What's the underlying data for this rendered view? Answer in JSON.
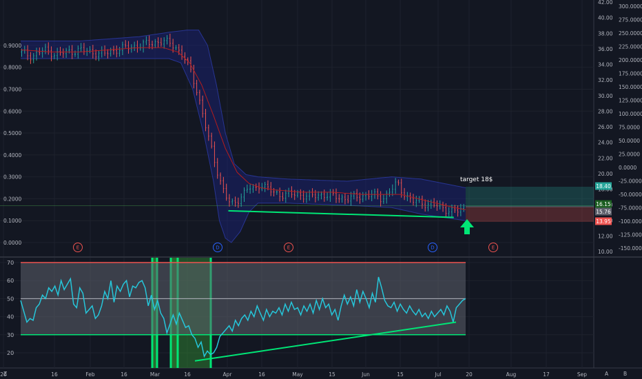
{
  "chart_data": [
    {
      "type": "candlestick",
      "title": "",
      "x_tick_labels": [
        "20",
        "16",
        "Feb",
        "16",
        "Mar",
        "16",
        "Apr",
        "16",
        "May",
        "15",
        "Jun",
        "15",
        "Jul",
        "20",
        "Aug",
        "17",
        "Sep"
      ],
      "left_axis": {
        "ticks": [
          "0.9000",
          "0.8000",
          "0.7000",
          "0.6000",
          "0.5000",
          "0.4000",
          "0.3000",
          "0.2000",
          "0.1000",
          "0.0000"
        ],
        "ylim": [
          -0.02,
          0.99
        ]
      },
      "right_axis_price": {
        "ticks": [
          "42.00",
          "40.00",
          "38.00",
          "36.00",
          "34.00",
          "32.00",
          "30.00",
          "28.00",
          "26.00",
          "24.00",
          "22.00",
          "20.00",
          "18.00",
          "16.00",
          "14.00",
          "12.00",
          "10.00"
        ]
      },
      "right_axis_indicator": {
        "ticks": [
          "300.0000",
          "275.0000",
          "250.0000",
          "225.0000",
          "200.0000",
          "175.0000",
          "150.0000",
          "125.0000",
          "100.0000",
          "75.0000",
          "50.0000",
          "25.0000",
          "0.0000",
          "-25.0000",
          "-50.0000",
          "-75.0000",
          "-100.0000",
          "-125.0000",
          "-150.0000"
        ]
      },
      "price_tags": [
        {
          "label": "18.40",
          "color": "#26a69a"
        },
        {
          "label": "16.15",
          "color": "#1b5e20"
        },
        {
          "label": "15.76",
          "color": "#5d606b"
        },
        {
          "label": "13.95",
          "color": "#ef5350"
        }
      ],
      "close_path": [
        [
          0,
          0.87
        ],
        [
          4,
          0.85
        ],
        [
          8,
          0.88
        ],
        [
          12,
          0.86
        ],
        [
          16,
          0.87
        ],
        [
          20,
          0.88
        ],
        [
          24,
          0.87
        ],
        [
          28,
          0.86
        ],
        [
          32,
          0.88
        ],
        [
          36,
          0.89
        ],
        [
          40,
          0.9
        ],
        [
          44,
          0.91
        ],
        [
          48,
          0.92
        ],
        [
          52,
          0.9
        ],
        [
          55,
          0.85
        ],
        [
          57,
          0.8
        ],
        [
          59,
          0.72
        ],
        [
          61,
          0.62
        ],
        [
          63,
          0.5
        ],
        [
          65,
          0.4
        ],
        [
          67,
          0.3
        ],
        [
          69,
          0.22
        ],
        [
          71,
          0.17
        ],
        [
          73,
          0.19
        ],
        [
          75,
          0.22
        ],
        [
          77,
          0.25
        ],
        [
          79,
          0.24
        ],
        [
          81,
          0.27
        ],
        [
          83,
          0.25
        ],
        [
          85,
          0.23
        ],
        [
          87,
          0.22
        ],
        [
          90,
          0.22
        ],
        [
          94,
          0.22
        ],
        [
          98,
          0.21
        ],
        [
          102,
          0.22
        ],
        [
          106,
          0.21
        ],
        [
          110,
          0.2
        ],
        [
          114,
          0.21
        ],
        [
          118,
          0.22
        ],
        [
          122,
          0.2
        ],
        [
          125,
          0.24
        ],
        [
          127,
          0.27
        ],
        [
          129,
          0.23
        ],
        [
          132,
          0.19
        ],
        [
          136,
          0.18
        ],
        [
          140,
          0.17
        ],
        [
          144,
          0.15
        ],
        [
          147,
          0.14
        ],
        [
          150,
          0.16
        ]
      ],
      "moving_average": [
        [
          0,
          0.88
        ],
        [
          10,
          0.87
        ],
        [
          20,
          0.87
        ],
        [
          30,
          0.88
        ],
        [
          40,
          0.89
        ],
        [
          48,
          0.89
        ],
        [
          53,
          0.87
        ],
        [
          57,
          0.82
        ],
        [
          61,
          0.72
        ],
        [
          65,
          0.58
        ],
        [
          69,
          0.43
        ],
        [
          73,
          0.32
        ],
        [
          77,
          0.27
        ],
        [
          81,
          0.25
        ],
        [
          86,
          0.24
        ],
        [
          95,
          0.23
        ],
        [
          105,
          0.23
        ],
        [
          115,
          0.22
        ],
        [
          122,
          0.22
        ],
        [
          128,
          0.22
        ],
        [
          134,
          0.2
        ],
        [
          140,
          0.18
        ],
        [
          146,
          0.16
        ],
        [
          150,
          0.15
        ]
      ],
      "bands_upper": [
        [
          0,
          0.92
        ],
        [
          20,
          0.92
        ],
        [
          40,
          0.94
        ],
        [
          50,
          0.96
        ],
        [
          56,
          0.97
        ],
        [
          60,
          0.97
        ],
        [
          63,
          0.9
        ],
        [
          66,
          0.72
        ],
        [
          69,
          0.5
        ],
        [
          72,
          0.36
        ],
        [
          76,
          0.31
        ],
        [
          80,
          0.3
        ],
        [
          90,
          0.29
        ],
        [
          110,
          0.28
        ],
        [
          125,
          0.3
        ],
        [
          135,
          0.29
        ],
        [
          150,
          0.25
        ]
      ],
      "bands_lower": [
        [
          0,
          0.84
        ],
        [
          20,
          0.84
        ],
        [
          40,
          0.84
        ],
        [
          50,
          0.84
        ],
        [
          54,
          0.82
        ],
        [
          58,
          0.7
        ],
        [
          62,
          0.48
        ],
        [
          65,
          0.28
        ],
        [
          67,
          0.1
        ],
        [
          69,
          0.02
        ],
        [
          71,
          0.0
        ],
        [
          74,
          0.05
        ],
        [
          77,
          0.14
        ],
        [
          80,
          0.18
        ],
        [
          90,
          0.18
        ],
        [
          110,
          0.17
        ],
        [
          125,
          0.16
        ],
        [
          135,
          0.13
        ],
        [
          150,
          0.1
        ]
      ],
      "support_line": [
        [
          70,
          0.145
        ],
        [
          146,
          0.115
        ]
      ],
      "events": [
        {
          "label": "E",
          "color": "#ef5350"
        },
        {
          "label": "D",
          "color": "#2962ff"
        },
        {
          "label": "E",
          "color": "#ef5350"
        },
        {
          "label": "D",
          "color": "#2962ff"
        },
        {
          "label": "E",
          "color": "#ef5350"
        }
      ],
      "annotation": "target 18$"
    },
    {
      "type": "line",
      "title": "",
      "ylim": [
        10,
        72
      ],
      "y_ticks": [
        "70",
        "60",
        "50",
        "40",
        "30",
        "20"
      ],
      "levels": {
        "upper": 70,
        "middle": 50,
        "lower": 30
      },
      "series": [
        {
          "color": "#26c6da",
          "values": [
            49,
            43,
            37,
            39,
            38,
            45,
            47,
            52,
            50,
            56,
            54,
            57,
            52,
            60,
            55,
            58,
            61,
            47,
            45,
            56,
            53,
            42,
            44,
            46,
            39,
            41,
            46,
            54,
            50,
            60,
            48,
            57,
            54,
            58,
            60,
            51,
            57,
            56,
            59,
            60,
            56,
            46,
            52,
            44,
            49,
            42,
            39,
            31,
            36,
            41,
            36,
            42,
            38,
            34,
            35,
            30,
            28,
            23,
            26,
            18,
            21,
            19,
            20,
            23,
            29,
            31,
            33,
            35,
            32,
            38,
            35,
            39,
            41,
            38,
            43,
            40,
            46,
            42,
            38,
            44,
            40,
            43,
            42,
            45,
            41,
            47,
            43,
            48,
            44,
            45,
            41,
            46,
            43,
            47,
            42,
            49,
            44,
            50,
            45,
            47,
            41,
            44,
            38,
            46,
            52,
            47,
            51,
            46,
            55,
            48,
            54,
            50,
            45,
            53,
            48,
            62,
            56,
            49,
            46,
            45,
            48,
            43,
            47,
            44,
            42,
            46,
            43,
            41,
            44,
            40,
            42,
            39,
            43,
            40,
            42,
            44,
            41,
            46,
            43,
            37,
            45,
            47,
            49,
            50
          ]
        }
      ],
      "divergence_line": [
        [
          10,
          15.5
        ],
        [
          25,
          37
        ]
      ],
      "highlight_zones": []
    }
  ]
}
